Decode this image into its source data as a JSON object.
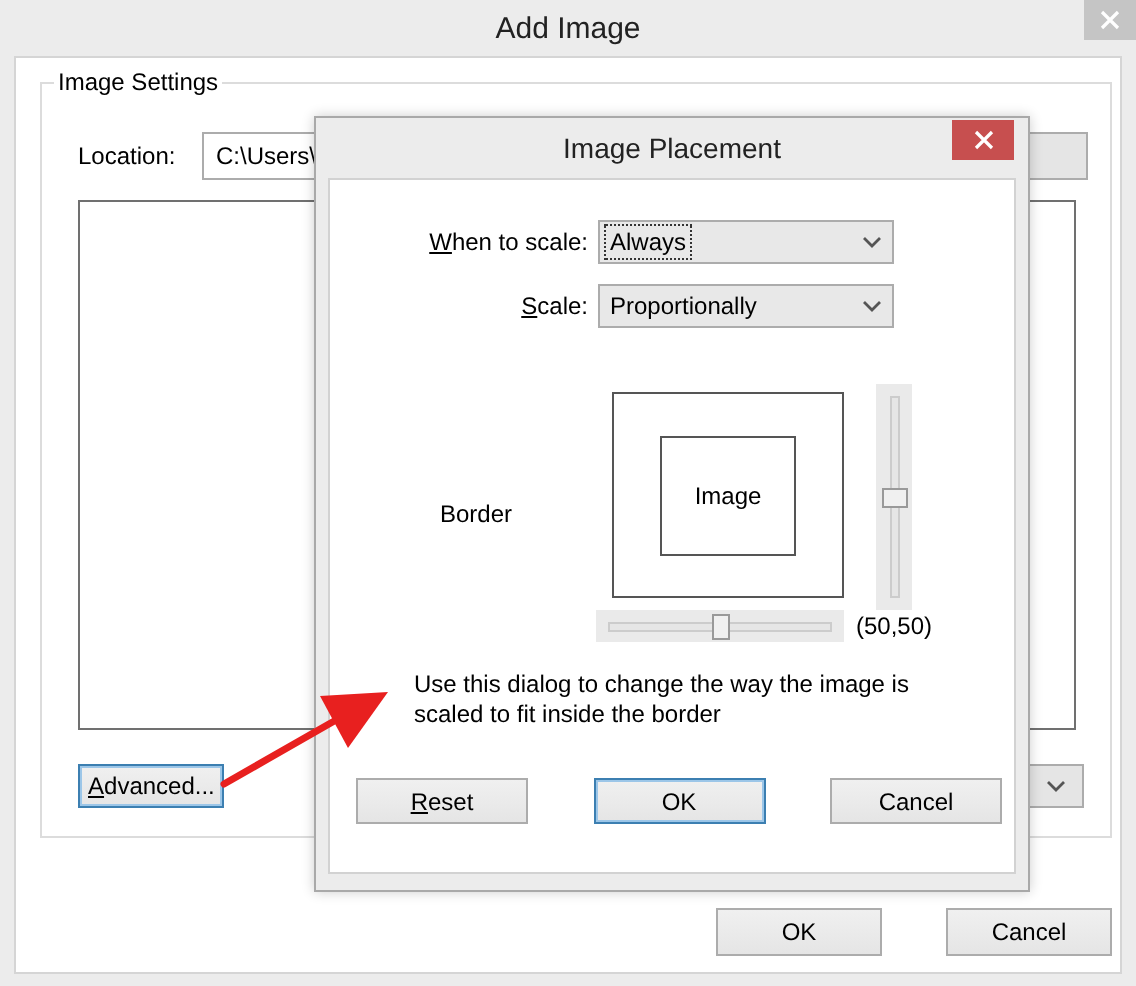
{
  "window": {
    "title": "Add Image"
  },
  "image_settings": {
    "title": "Image Settings",
    "location_label": "Location:",
    "location_value": "C:\\Users\\"
  },
  "advanced_button": {
    "label": "Advanced...",
    "underline_first": true,
    "focused": true
  },
  "buttons": [
    {
      "label": "OK"
    },
    {
      "label": "Cancel"
    }
  ],
  "dialog": {
    "title": "Image Placement",
    "fields": [
      {
        "label": "When to scale:",
        "underline_first": true,
        "value": "Always",
        "focused": true
      },
      {
        "label": "Scale:",
        "underline_first": true,
        "value": "Proportionally",
        "focused": false
      }
    ],
    "border_label": "Border",
    "preview_label": "Image",
    "horizontal_slider": {
      "level": 0.5
    },
    "vertical_slider": {
      "level": 0.5
    },
    "reading": "(50,50)",
    "description": "Use this dialog to change the way the image is scaled to fit inside the border",
    "buttons": [
      {
        "label": "Reset",
        "underline_first": true,
        "focused": false
      },
      {
        "label": "OK",
        "underline_first": false,
        "focused": true
      },
      {
        "label": "Cancel",
        "underline_first": false,
        "focused": false
      }
    ]
  }
}
